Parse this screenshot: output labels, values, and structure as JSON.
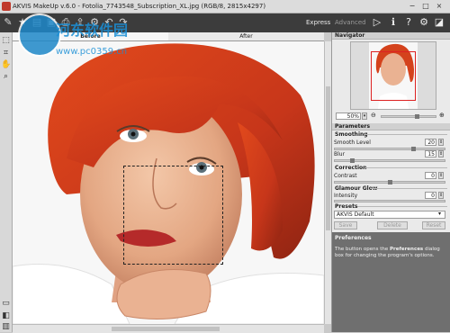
{
  "window": {
    "title": "AKVIS MakeUp v.6.0 - Fotolia_7743548_Subscription_XL.jpg (RGB/8, 2815x4297)",
    "minimize": "−",
    "maximize": "□",
    "close": "×"
  },
  "toolbar": {
    "mode_express": "Express",
    "mode_advanced": "Advanced",
    "icons": [
      "open-icon",
      "save-icon",
      "print-icon",
      "share-icon",
      "settings-icon",
      "undo-icon",
      "redo-icon",
      "preview-icon"
    ]
  },
  "watermark": {
    "text": "河东软件园",
    "url": "www.pc0359.cn"
  },
  "tabs": {
    "before": "Before",
    "after": "After"
  },
  "navigator": {
    "title": "Navigator",
    "zoom": "50%"
  },
  "parameters": {
    "title": "Parameters",
    "smoothing": {
      "title": "Smoothing",
      "smooth_level_label": "Smooth Level",
      "smooth_level_value": "20",
      "blur_label": "Blur",
      "blur_value": "15"
    },
    "correction": {
      "title": "Correction",
      "contrast_label": "Contrast",
      "contrast_value": "0"
    },
    "glamour": {
      "title": "Glamour Glow",
      "intensity_label": "Intensity",
      "intensity_value": "0"
    }
  },
  "presets": {
    "title": "Presets",
    "selected": "AKVIS Default",
    "save_label": "Save",
    "delete_label": "Delete",
    "reset_label": "Reset"
  },
  "help": {
    "title": "Preferences",
    "text_before": "The button opens the ",
    "text_bold": "Preferences",
    "text_after": " dialog box for changing the program's options."
  },
  "colors": {
    "toolbar_bg": "#3c3c3c",
    "panel_bg": "#eaeaea",
    "hair": "#d2451e",
    "help_bg": "#6f6f6f"
  }
}
